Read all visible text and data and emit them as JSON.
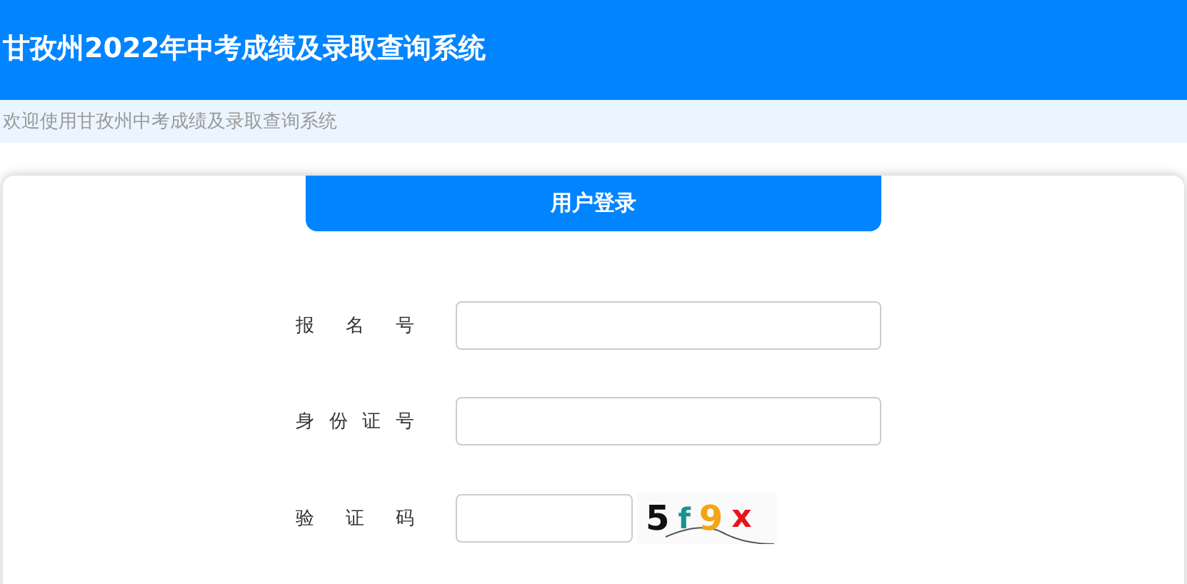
{
  "header": {
    "title": "甘孜州2022年中考成绩及录取查询系统"
  },
  "welcome": "欢迎使用甘孜州中考成绩及录取查询系统",
  "login": {
    "title": "用户登录",
    "fields": [
      {
        "kind": "text",
        "label": "报名号"
      },
      {
        "kind": "text",
        "label": "身份证号"
      },
      {
        "kind": "captcha",
        "label": "验证码"
      }
    ],
    "captcha": [
      {
        "text": "5",
        "color": "#111111"
      },
      {
        "text": "f",
        "color": "#16938f"
      },
      {
        "text": "9",
        "color": "#f2a516"
      },
      {
        "text": "x",
        "color": "#e8141b"
      }
    ]
  }
}
